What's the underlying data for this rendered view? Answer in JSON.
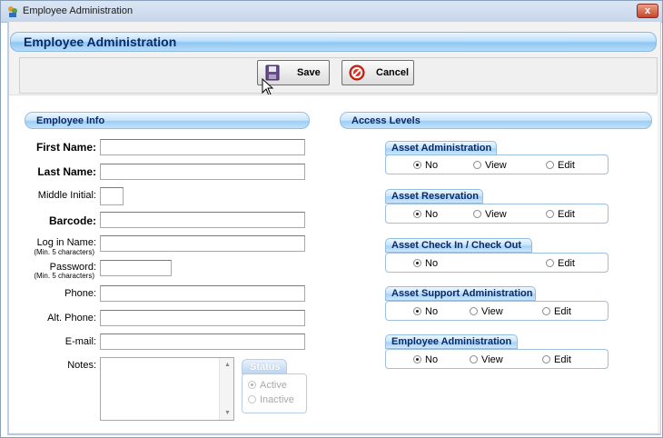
{
  "window": {
    "title": "Employee Administration",
    "close_label": "x"
  },
  "header": {
    "title": "Employee Administration"
  },
  "toolbar": {
    "save_label": "Save",
    "cancel_label": "Cancel"
  },
  "employee_info": {
    "section_title": "Employee Info",
    "fields": {
      "first_name": {
        "label": "First Name:",
        "value": ""
      },
      "last_name": {
        "label": "Last Name:",
        "value": ""
      },
      "middle_initial": {
        "label": "Middle Initial:",
        "value": ""
      },
      "barcode": {
        "label": "Barcode:",
        "value": ""
      },
      "login_name": {
        "label": "Log in Name:",
        "hint": "(Min. 5 characters)",
        "value": ""
      },
      "password": {
        "label": "Password:",
        "hint": "(Min. 5 characters)",
        "value": ""
      },
      "phone": {
        "label": "Phone:",
        "value": ""
      },
      "alt_phone": {
        "label": "Alt. Phone:",
        "value": ""
      },
      "email": {
        "label": "E-mail:",
        "value": ""
      },
      "notes": {
        "label": "Notes:",
        "value": ""
      }
    },
    "status": {
      "title": "Status",
      "options": [
        "Active",
        "Inactive"
      ],
      "selected": "Active",
      "enabled": false
    }
  },
  "access_levels": {
    "section_title": "Access Levels",
    "groups": [
      {
        "title": "Asset Administration",
        "opt_no": "No",
        "opt_view": "View",
        "opt_edit": "Edit",
        "selected": "No"
      },
      {
        "title": "Asset Reservation",
        "opt_no": "No",
        "opt_view": "View",
        "opt_edit": "Edit",
        "selected": "No"
      },
      {
        "title": "Asset Check In / Check Out",
        "opt_no": "No",
        "opt_edit": "Edit",
        "selected": "No"
      },
      {
        "title": "Asset Support Administration",
        "opt_no": "No",
        "opt_view": "View",
        "opt_edit": "Edit",
        "selected": "No"
      },
      {
        "title": "Employee Administration",
        "opt_no": "No",
        "opt_view": "View",
        "opt_edit": "Edit",
        "selected": "No"
      }
    ]
  }
}
